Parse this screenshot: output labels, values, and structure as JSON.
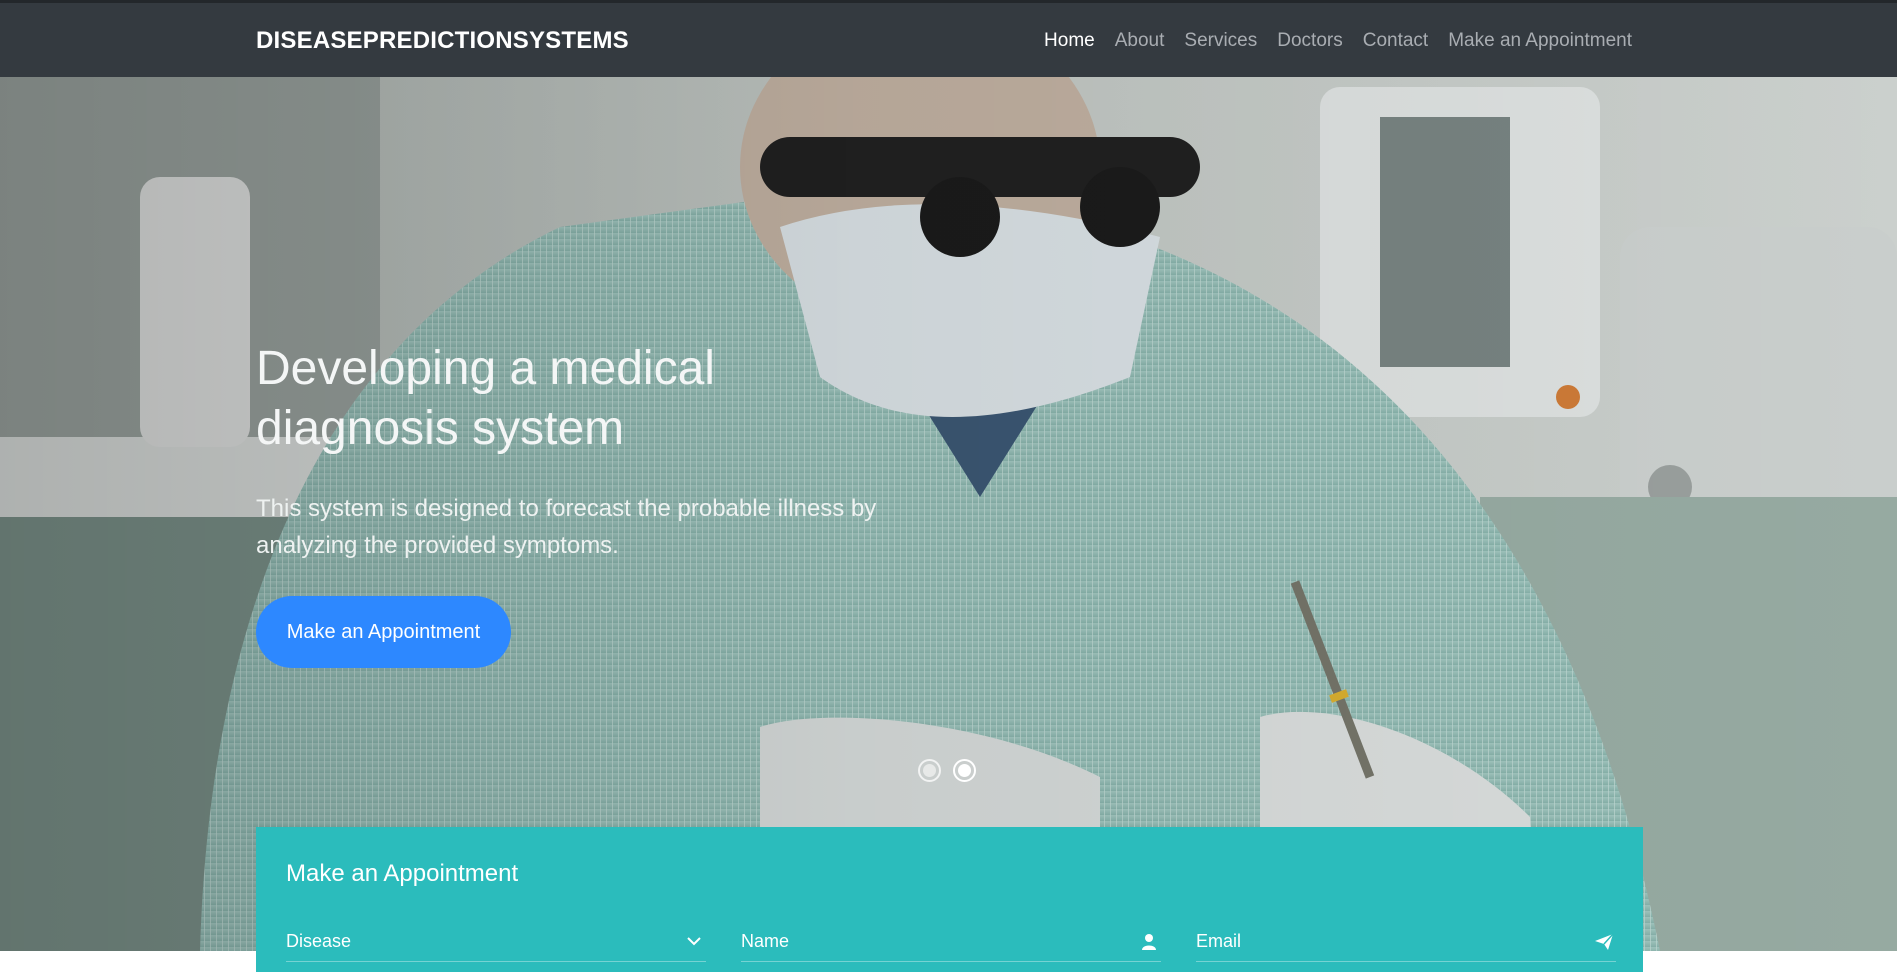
{
  "navbar": {
    "brand": "DISEASEPREDICTIONSYSTEMS",
    "links": [
      "Home",
      "About",
      "Services",
      "Doctors",
      "Contact",
      "Make an Appointment"
    ]
  },
  "hero": {
    "title": "Developing a medical diagnosis system",
    "text": "This system is designed to forecast the probable illness by analyzing the provided symptoms.",
    "button": "Make an Appointment"
  },
  "appointment": {
    "title": "Make an Appointment",
    "disease_label": "Disease",
    "name_label": "Name",
    "email_label": "Email"
  },
  "colors": {
    "navbar": "#343a40",
    "primary_button": "#2d88ff",
    "appointment_bg": "#2bbcbc"
  },
  "icons": {
    "disease": "chevron-down-icon",
    "name": "user-icon",
    "email": "paper-plane-icon"
  }
}
